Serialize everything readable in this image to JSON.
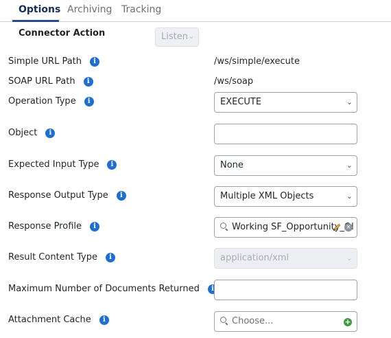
{
  "tabs": [
    {
      "label": "Options",
      "active": true
    },
    {
      "label": "Archiving",
      "active": false
    },
    {
      "label": "Tracking",
      "active": false
    }
  ],
  "connector_action": {
    "label": "Connector Action",
    "value": "Listen"
  },
  "fields": {
    "simple_url_path": {
      "label": "Simple URL Path",
      "value": "/ws/simple/execute"
    },
    "soap_url_path": {
      "label": "SOAP URL Path",
      "value": "/ws/soap"
    },
    "operation_type": {
      "label": "Operation Type",
      "value": "EXECUTE"
    },
    "object": {
      "label": "Object",
      "value": ""
    },
    "expected_input_type": {
      "label": "Expected Input Type",
      "value": "None"
    },
    "response_output_type": {
      "label": "Response Output Type",
      "value": "Multiple XML Objects"
    },
    "response_profile": {
      "label": "Response Profile",
      "value": "Working SF_Opportunity_Ol"
    },
    "result_content_type": {
      "label": "Result Content Type",
      "value": "application/xml"
    },
    "max_documents": {
      "label": "Maximum Number of Documents Returned",
      "value": ""
    },
    "attachment_cache": {
      "label": "Attachment Cache",
      "placeholder": "Choose..."
    }
  },
  "icons": {
    "info": "info-icon",
    "select": "chevron-down-icon",
    "search": "search-icon",
    "edit": "pencil-icon",
    "clear": "clear-icon",
    "add": "add-icon"
  },
  "colors": {
    "info_blue": "#1f6fd1",
    "tab_active": "#1a2d5a",
    "add_green": "#3c9a3c"
  }
}
